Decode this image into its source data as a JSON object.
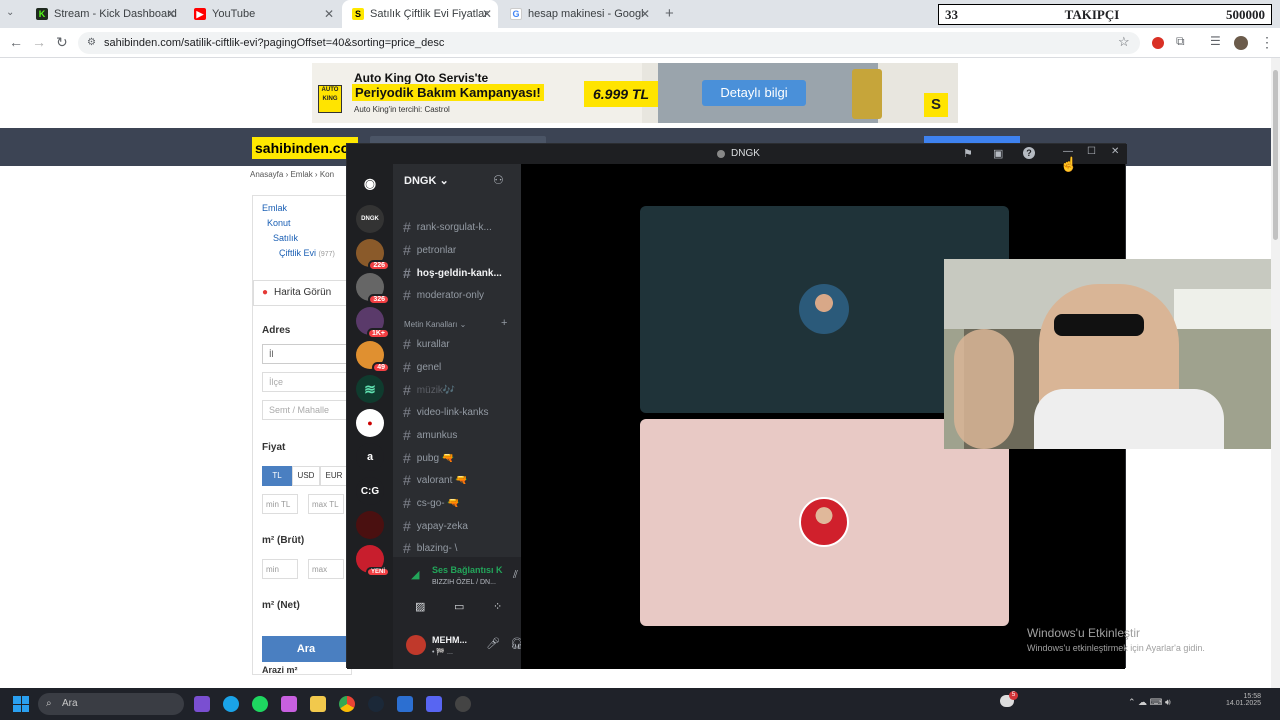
{
  "browser": {
    "tabs": [
      {
        "title": "Stream - Kick Dashboard",
        "icon": "kick-icon"
      },
      {
        "title": "YouTube",
        "icon": "youtube-icon"
      },
      {
        "title": "Satılık Çiftlik Evi Fiyatları sahibin",
        "icon": "sahibinden-icon"
      },
      {
        "title": "hesap makinesi - Google'da Ar",
        "icon": "google-icon"
      }
    ],
    "url": "sahibinden.com/satilik-ciftlik-evi?pagingOffset=40&sorting=price_desc"
  },
  "overlay": {
    "left": "33",
    "center": "TAKIPÇI",
    "right": "500000"
  },
  "ad": {
    "line1": "Auto King Oto Servis'te",
    "line2": "Periyodik Bakım Kampanyası!",
    "line3": "Auto King'in tercihi: Castrol",
    "price": "6.999 TL",
    "cta": "Detaylı bilgi"
  },
  "site": {
    "logo": "sahibinden.com",
    "breadcrumb": [
      "Anasayfa",
      "Emlak",
      "Kon"
    ],
    "categories": [
      "Emlak",
      "Konut",
      "Satılık",
      "Çiftlik Evi"
    ],
    "category_count": "(977)",
    "map_button": "Harita Görün",
    "address_title": "Adres",
    "address_fields": [
      "İl",
      "İlçe",
      "Semt / Mahalle"
    ],
    "price_title": "Fiyat",
    "currencies": [
      "TL",
      "USD",
      "EUR"
    ],
    "min_tl": "min TL",
    "max_tl": "max TL",
    "area_gross_title": "m² (Brüt)",
    "min": "min",
    "max": "max",
    "area_net_title": "m² (Net)",
    "land_title": "Arazi m²",
    "search_button": "Ara"
  },
  "discord": {
    "window_title": "DNGK",
    "server_name": "DNGK",
    "servers": [
      {
        "label": "DNGK",
        "badge": ""
      },
      {
        "label": "",
        "badge": "226"
      },
      {
        "label": "",
        "badge": "326"
      },
      {
        "label": "",
        "badge": "1K+"
      },
      {
        "label": "",
        "badge": "49"
      },
      {
        "label": "",
        "badge": ""
      },
      {
        "label": "",
        "badge": ""
      },
      {
        "label": "a",
        "badge": ""
      },
      {
        "label": "C:G",
        "badge": ""
      },
      {
        "label": "",
        "badge": ""
      },
      {
        "label": "",
        "badge": "YENİ"
      }
    ],
    "channels_top": [
      {
        "name": "rank-sorgulat-k...",
        "active": false
      },
      {
        "name": "petronlar",
        "active": false
      },
      {
        "name": "hoş-geldin-kank...",
        "active": true
      },
      {
        "name": "moderator-only",
        "active": false
      }
    ],
    "category": "Metin Kanalları",
    "channels": [
      {
        "name": "kurallar",
        "muted": false
      },
      {
        "name": "genel",
        "muted": false
      },
      {
        "name": "müzik🎶",
        "muted": true
      },
      {
        "name": "video-link-kanks",
        "muted": false
      },
      {
        "name": "amunkus",
        "muted": false
      },
      {
        "name": "pubg 🔫",
        "muted": false
      },
      {
        "name": "valorant 🔫",
        "muted": false
      },
      {
        "name": "cs-go- 🔫",
        "muted": false
      },
      {
        "name": "yapay-zeka",
        "muted": false
      },
      {
        "name": "blazing- \\",
        "muted": false
      }
    ],
    "voice_status": "Ses Bağlantısı K",
    "voice_channel": "BIZZIH ÖZEL / DN...",
    "user_name": "MEHM...",
    "user_status": "• 🏁 ..."
  },
  "windows": {
    "watermark_title": "Windows'u Etkinleştir",
    "watermark_sub": "Windows'u etkinleştirmek için Ayarlar'a gidin.",
    "search_placeholder": "Ara",
    "notification_count": "5",
    "time": "15:58",
    "date": "14.01.2025"
  },
  "colors": {
    "discord_bg": "#2b2d31",
    "tile1": "#1f3339",
    "tile2": "#e8c9c5",
    "sahibinden_yellow": "#ffe800",
    "taskbar": "#1f2229"
  }
}
